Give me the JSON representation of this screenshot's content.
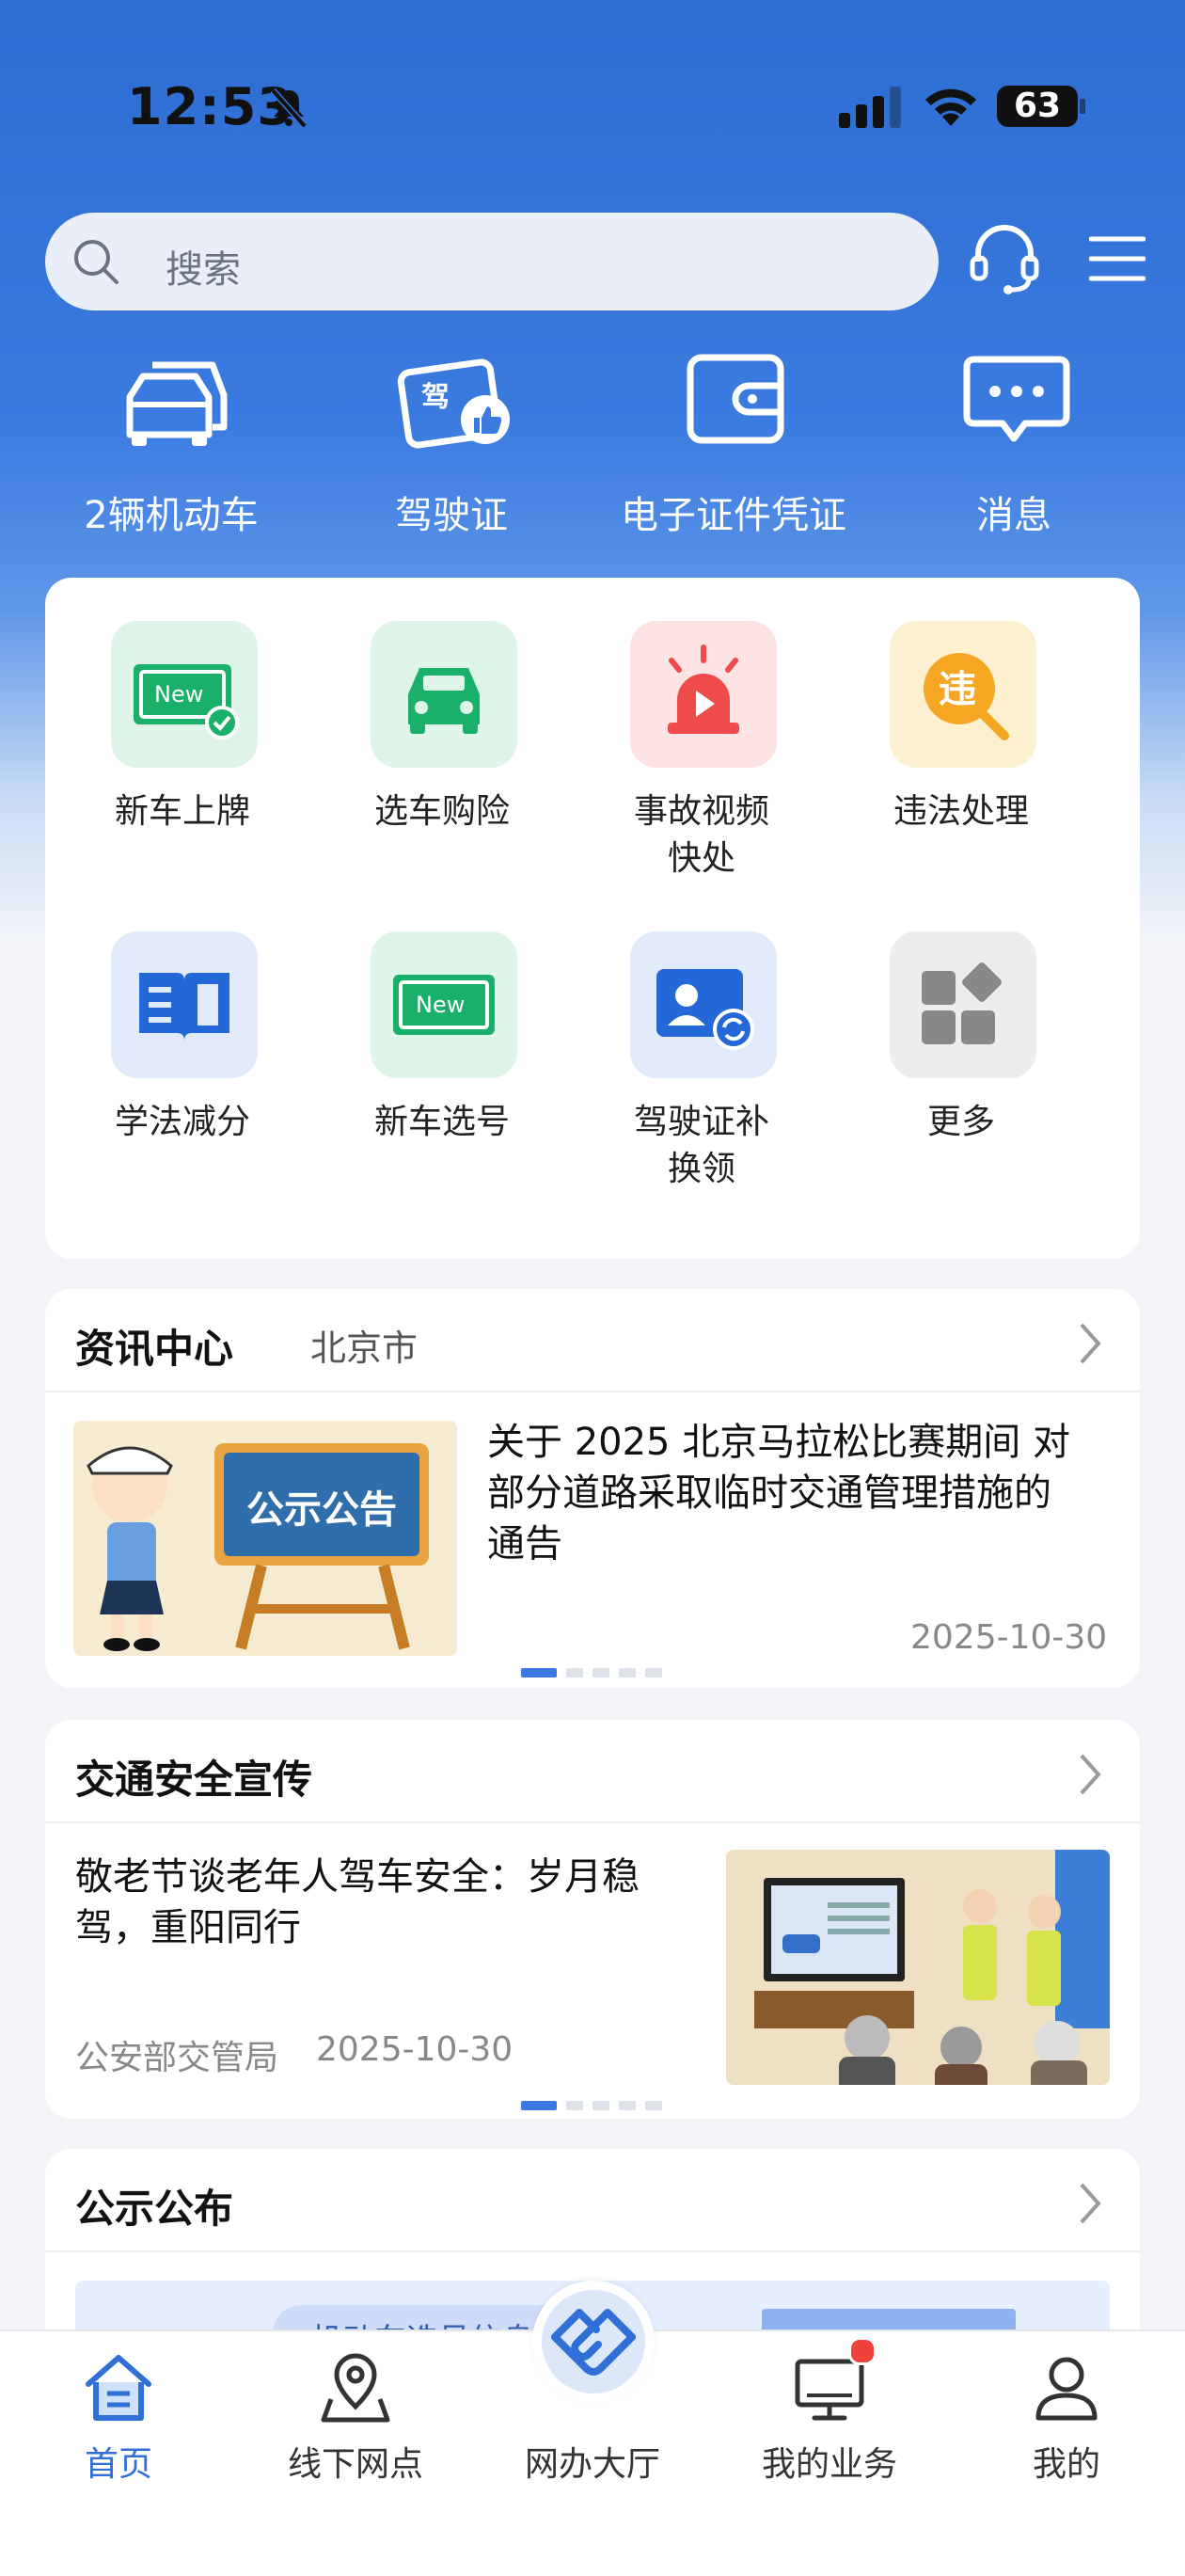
{
  "status_bar": {
    "time": "12:53",
    "battery": "63"
  },
  "search": {
    "placeholder": "搜索"
  },
  "quick_actions": [
    {
      "label": "2辆机动车",
      "icon": "cars-icon"
    },
    {
      "label": "驾驶证",
      "icon": "license-thumb-icon"
    },
    {
      "label": "电子证件凭证",
      "icon": "wallet-icon"
    },
    {
      "label": "消息",
      "icon": "message-icon"
    }
  ],
  "services": [
    {
      "label": "新车上牌",
      "icon": "new-plate-check-icon",
      "tile": "#dff5e9"
    },
    {
      "label": "选车购险",
      "icon": "car-front-icon",
      "tile": "#dff5e9"
    },
    {
      "label": "事故视频快处",
      "line1": "事故视频",
      "line2": "快处",
      "icon": "alarm-video-icon",
      "tile": "#fde3e3"
    },
    {
      "label": "违法处理",
      "icon": "violation-search-icon",
      "tile": "#fdf0d0"
    },
    {
      "label": "学法减分",
      "icon": "book-icon",
      "tile": "#e2ebfb"
    },
    {
      "label": "新车选号",
      "icon": "new-plate-icon",
      "tile": "#dff5e9"
    },
    {
      "label": "驾驶证补换领",
      "line1": "驾驶证补",
      "line2": "换领",
      "icon": "license-renew-icon",
      "tile": "#e2ebfb"
    },
    {
      "label": "更多",
      "icon": "more-apps-icon",
      "tile": "#ededed"
    }
  ],
  "news_center": {
    "title": "资讯中心",
    "city": "北京市",
    "article": {
      "image_text": "公示公告",
      "title": "关于 2025 北京马拉松比赛期间 对部分道路采取临时交通管理措施的通告",
      "line1": "关于 2025 北京马拉松比赛期间 对",
      "line2": "部分道路采取临时交通管理措施的",
      "line3": "通告",
      "date": "2025-10-30"
    }
  },
  "safety": {
    "title": "交通安全宣传",
    "article": {
      "line1": "敬老节谈老年人驾车安全：岁月稳",
      "line2": "驾，重阳同行",
      "source": "公安部交管局",
      "date": "2025-10-30"
    }
  },
  "notice": {
    "title": "公示公布",
    "banner_text": "机动车选号信息公"
  },
  "tabs": [
    {
      "label": "首页",
      "icon": "home-icon",
      "active": true
    },
    {
      "label": "线下网点",
      "icon": "location-pin-icon"
    },
    {
      "label": "网办大厅",
      "icon": "handshake-icon"
    },
    {
      "label": "我的业务",
      "icon": "monitor-icon"
    },
    {
      "label": "我的",
      "icon": "user-icon"
    }
  ]
}
